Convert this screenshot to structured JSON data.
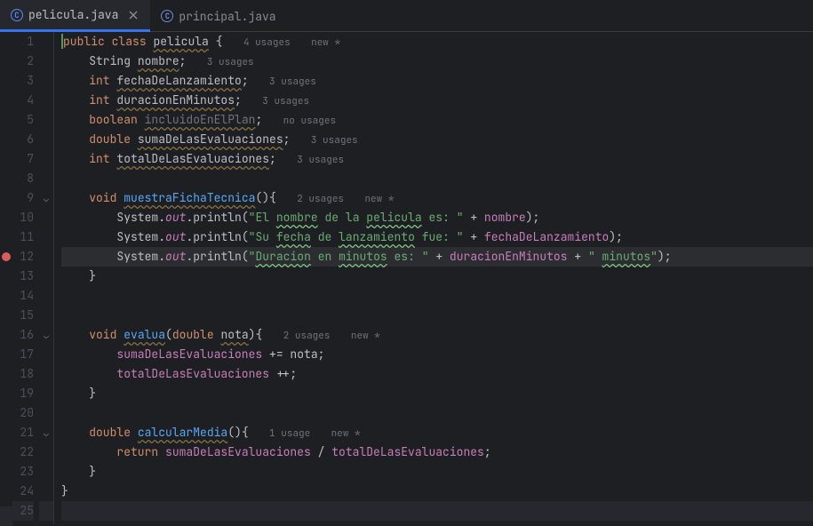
{
  "tabs": [
    {
      "label": "pelicula.java",
      "active": true
    },
    {
      "label": "principal.java",
      "active": false
    }
  ],
  "lines": {
    "l1": {
      "num": "1",
      "fold": "",
      "bp": false
    },
    "l2": {
      "num": "2",
      "fold": "",
      "bp": false
    },
    "l3": {
      "num": "3",
      "fold": "",
      "bp": false
    },
    "l4": {
      "num": "4",
      "fold": "",
      "bp": false
    },
    "l5": {
      "num": "5",
      "fold": "",
      "bp": false
    },
    "l6": {
      "num": "6",
      "fold": "",
      "bp": false
    },
    "l7": {
      "num": "7",
      "fold": "",
      "bp": false
    },
    "l8": {
      "num": "8",
      "fold": "",
      "bp": false
    },
    "l9": {
      "num": "9",
      "fold": "v",
      "bp": false
    },
    "l10": {
      "num": "10",
      "fold": "",
      "bp": false
    },
    "l11": {
      "num": "11",
      "fold": "",
      "bp": false
    },
    "l12": {
      "num": "12",
      "fold": "",
      "bp": true
    },
    "l13": {
      "num": "13",
      "fold": "",
      "bp": false
    },
    "l14": {
      "num": "14",
      "fold": "",
      "bp": false
    },
    "l15": {
      "num": "15",
      "fold": "",
      "bp": false
    },
    "l16": {
      "num": "16",
      "fold": "v",
      "bp": false
    },
    "l17": {
      "num": "17",
      "fold": "",
      "bp": false
    },
    "l18": {
      "num": "18",
      "fold": "",
      "bp": false
    },
    "l19": {
      "num": "19",
      "fold": "",
      "bp": false
    },
    "l20": {
      "num": "20",
      "fold": "",
      "bp": false
    },
    "l21": {
      "num": "21",
      "fold": "v",
      "bp": false
    },
    "l22": {
      "num": "22",
      "fold": "",
      "bp": false
    },
    "l23": {
      "num": "23",
      "fold": "",
      "bp": false
    },
    "l24": {
      "num": "24",
      "fold": "",
      "bp": false
    },
    "l25": {
      "num": "25",
      "fold": "",
      "bp": false
    }
  },
  "hints": {
    "l1": "4 usages",
    "l1b": "new *",
    "l2": "3 usages",
    "l3": "3 usages",
    "l4": "3 usages",
    "l5": "no usages",
    "l6": "3 usages",
    "l7": "3 usages",
    "l9": "2 usages",
    "l9b": "new *",
    "l16": "2 usages",
    "l16b": "new *",
    "l21": "1 usage",
    "l21b": "new *"
  },
  "kw": {
    "public": "public",
    "class": "class",
    "int": "int",
    "boolean": "boolean",
    "double": "double",
    "void": "void",
    "return": "return"
  },
  "code": {
    "pelicula": "pelicula",
    "String": "String",
    "nombre": "nombre",
    "fechaDeLanzamiento": "fechaDeLanzamiento",
    "duracionEnMinutos": "duracionEnMinutos",
    "incluidoEnElPlan": "incluidoEnElPlan",
    "sumaDeLasEvaluaciones": "sumaDeLasEvaluaciones",
    "totalDeLasEvaluaciones": "totalDeLasEvaluaciones",
    "muestraFichaTecnica": "muestraFichaTecnica",
    "System": "System",
    "out": "out",
    "println": "println",
    "evalua": "evalua",
    "nota": "nota",
    "calcularMedia": "calcularMedia"
  },
  "str": {
    "s1a": "\"El ",
    "s1b": "nombre",
    "s1c": " de la ",
    "s1d": "pelicula",
    "s1e": " es: \"",
    "s2a": "\"Su ",
    "s2b": "fecha",
    "s2c": " de ",
    "s2d": "lanzamiento",
    "s2e": " fue: \"",
    "s3a": "\"",
    "s3b": "Duracion",
    "s3c": " en ",
    "s3d": "minutos",
    "s3e": " es: \"",
    "s3f": "\" ",
    "s3g": "minutos",
    "s3h": "\""
  },
  "p": {
    "semi": ";",
    "obrace": " {",
    "cbrace": "}",
    "oparen": "(",
    "cparen": ")",
    "dot": ".",
    "plus": " + ",
    "pluseq": " += ",
    "plusplus": " ++;",
    "div": " / ",
    "cparensemi": ");",
    "cparenob": "){",
    "oparenclose": "(){"
  }
}
